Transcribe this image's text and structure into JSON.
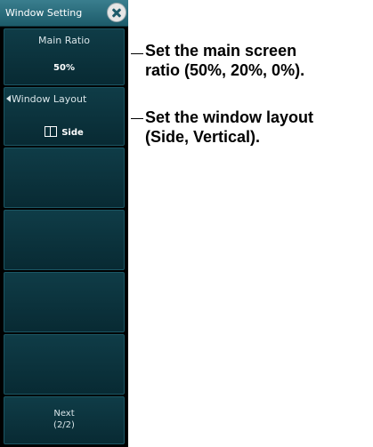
{
  "menu": {
    "title": "Window Setting",
    "keys": [
      {
        "label": "Main Ratio",
        "value": "50%"
      },
      {
        "label": "Window Layout",
        "value": "Side"
      },
      {
        "label": ""
      },
      {
        "label": ""
      },
      {
        "label": ""
      },
      {
        "label": ""
      },
      {
        "label": "Next",
        "sub": "(2/2)"
      }
    ]
  },
  "annotations": [
    {
      "line1": "Set the main screen",
      "line2": "ratio (50%, 20%, 0%)."
    },
    {
      "line1": "Set the window layout",
      "line2": "(Side, Vertical)."
    }
  ],
  "icons": {
    "close": "close-circle-icon",
    "left_arrow": "triangle-left-icon",
    "layout": "split-window-icon"
  },
  "colors": {
    "title_bar": "#2a6e7e",
    "key_background": "#0b3440",
    "key_border": "#1b5664",
    "panel_background": "#000000"
  }
}
